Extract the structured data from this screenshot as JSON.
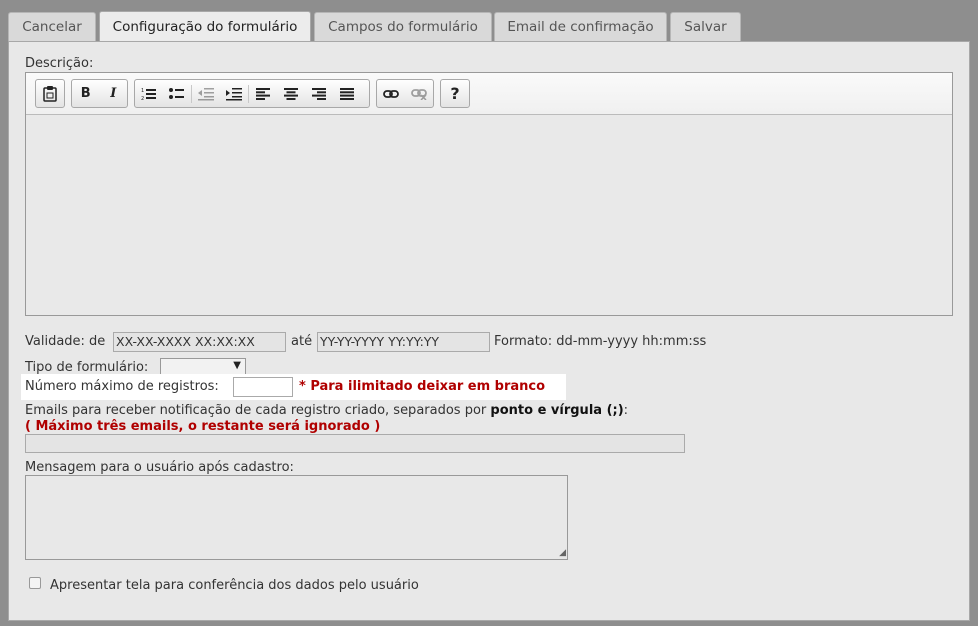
{
  "tabs": [
    {
      "label": "Cancelar"
    },
    {
      "label": "Configuração do formulário"
    },
    {
      "label": "Campos do formulário"
    },
    {
      "label": "Email de confirmação"
    },
    {
      "label": "Salvar"
    }
  ],
  "description": {
    "label": "Descrição:",
    "toolbar": {
      "paste": "paste-icon",
      "bold": "B",
      "italic": "I",
      "ordered_list": "ordered-list-icon",
      "unordered_list": "unordered-list-icon",
      "outdent": "outdent-icon",
      "indent": "indent-icon",
      "align_left": "align-left-icon",
      "align_center": "align-center-icon",
      "align_right": "align-right-icon",
      "justify": "justify-icon",
      "link": "link-icon",
      "unlink": "unlink-icon",
      "help": "?"
    }
  },
  "validity": {
    "label": "Validade: de",
    "from_value": "XX-XX-XXXX XX:XX:XX",
    "to_label": "até",
    "to_value": "YY-YY-YYYY YY:YY:YY",
    "format_label": "Formato: dd-mm-yyyy hh:mm:ss"
  },
  "form_type": {
    "label": "Tipo de formulário:",
    "value": ""
  },
  "max_records": {
    "label": "Número máximo de registros:",
    "value": "",
    "hint": "* Para ilimitado deixar em branco"
  },
  "emails": {
    "label_prefix": "Emails para receber notificação de cada registro criado, separados por",
    "label_bold": "ponto e vírgula (;)",
    "label_suffix": ":",
    "warning": "( Máximo três emails, o restante será ignorado )",
    "value": ""
  },
  "message": {
    "label": "Mensagem para o usuário após cadastro:",
    "value": ""
  },
  "confirm_screen": {
    "label": "Apresentar tela para conferência dos dados pelo usuário",
    "checked": false
  },
  "colors": {
    "page_bg": "#8e8e8e",
    "panel_bg": "#e8e8e8",
    "warning_red": "#b00000",
    "highlight": "#ffffff"
  }
}
